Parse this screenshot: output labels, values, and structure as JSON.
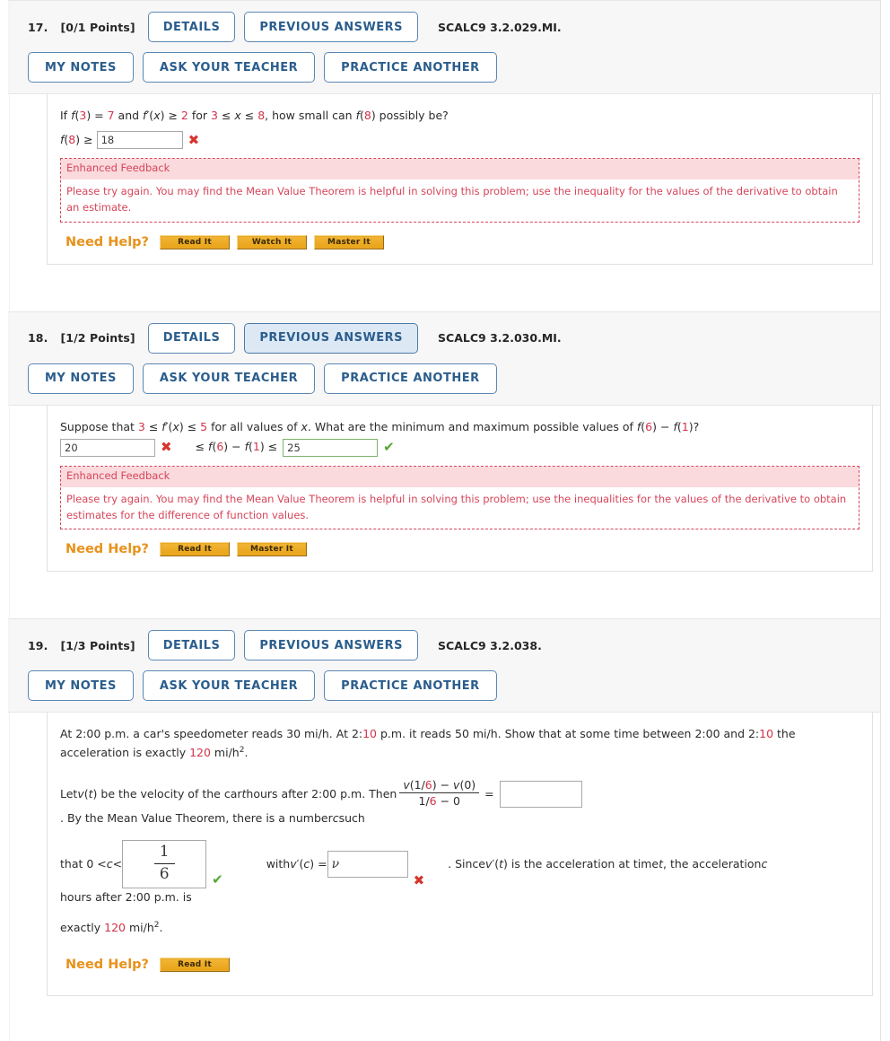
{
  "questions": [
    {
      "number": "17.",
      "points": "[0/1 Points]",
      "code": "SCALC9 3.2.029.MI.",
      "buttons": {
        "details": "DETAILS",
        "previous_answers": "PREVIOUS ANSWERS",
        "my_notes": "MY NOTES",
        "ask_your_teacher": "ASK YOUR TEACHER",
        "practice_another": "PRACTICE ANOTHER"
      },
      "previous_answers_active": false,
      "prompt": {
        "s1": "If ",
        "f1": "f",
        "p1": "(",
        "n3": "3",
        "p2": ") = ",
        "n7": "7",
        "s2": " and ",
        "f2": "f",
        "prime": "′",
        "p3": "(",
        "x1": "x",
        "p4": ") ≥ ",
        "n2": "2",
        "s3": " for ",
        "n3b": "3",
        "le1": " ≤ ",
        "x2": "x",
        "le2": " ≤ ",
        "n8": "8",
        "s4": ", how small can ",
        "f3": "f",
        "p5": "(",
        "n8b": "8",
        "p6": ") possibly be?"
      },
      "answer_line": {
        "f": "f",
        "open": "(",
        "arg": "8",
        "close": ") ≥ ",
        "value": "18",
        "mark": "✖"
      },
      "feedback": {
        "title": "Enhanced Feedback",
        "body": "Please try again. You may find the Mean Value Theorem is helpful in solving this problem; use the inequality for the values of the derivative to obtain an estimate."
      },
      "need_help": {
        "label": "Need Help?",
        "buttons": [
          "Read It",
          "Watch It",
          "Master It"
        ]
      }
    },
    {
      "number": "18.",
      "points": "[1/2 Points]",
      "code": "SCALC9 3.2.030.MI.",
      "buttons": {
        "details": "DETAILS",
        "previous_answers": "PREVIOUS ANSWERS",
        "my_notes": "MY NOTES",
        "ask_your_teacher": "ASK YOUR TEACHER",
        "practice_another": "PRACTICE ANOTHER"
      },
      "previous_answers_active": true,
      "prompt": {
        "s1": "Suppose that ",
        "n3": "3",
        "le1": " ≤ ",
        "f": "f",
        "prime": "′",
        "p1": "(",
        "x": "x",
        "p2": ") ≤ ",
        "n5": "5",
        "s2": " for all values of ",
        "x2": "x",
        "s3": ". What are the minimum and maximum possible values of ",
        "f2": "f",
        "p3": "(",
        "n6": "6",
        "p4": ") − ",
        "f3": "f",
        "p5": "(",
        "n1": "1",
        "p6": ")?"
      },
      "answer_line": {
        "min_value": "20",
        "min_mark": "✖",
        "mid_le1": "≤ ",
        "f1": "f",
        "o1": "(",
        "a1": "6",
        "c1": ") − ",
        "f2": "f",
        "o2": "(",
        "a2": "1",
        "c2": ") ≤",
        "max_value": "25",
        "max_mark": "✔"
      },
      "feedback": {
        "title": "Enhanced Feedback",
        "body": "Please try again. You may find the Mean Value Theorem is helpful in solving this problem; use the inequalities for the values of the derivative to obtain estimates for the difference of function values."
      },
      "need_help": {
        "label": "Need Help?",
        "buttons": [
          "Read It",
          "Master It"
        ]
      }
    },
    {
      "number": "19.",
      "points": "[1/3 Points]",
      "code": "SCALC9 3.2.038.",
      "buttons": {
        "details": "DETAILS",
        "previous_answers": "PREVIOUS ANSWERS",
        "my_notes": "MY NOTES",
        "ask_your_teacher": "ASK YOUR TEACHER",
        "practice_another": "PRACTICE ANOTHER"
      },
      "previous_answers_active": false,
      "prompt": {
        "s1": "At 2:00 p.m. a car's speedometer reads 30 mi/h. At 2:",
        "r1": "10",
        "s2": " p.m. it reads 50 mi/h. Show that at some time between 2:00 and 2:",
        "r2": "10",
        "s3": " the acceleration is exactly ",
        "r3": "120",
        "s4": " mi/h",
        "sup": "2",
        "s5": "."
      },
      "para2": {
        "s1": "Let ",
        "v1": "v",
        "p1": "(",
        "t1": "t",
        "p2": ") be the velocity of the car ",
        "t2": "t",
        "p3": " hours after 2:00 p.m. Then ",
        "frac_num_a": "v",
        "frac_num_b": "(1/",
        "frac_num_red": "6",
        "frac_num_c": ") − ",
        "frac_num_d": "v",
        "frac_num_e": "(0)",
        "frac_den_a": "1/",
        "frac_den_red": "6",
        "frac_den_b": " − 0",
        "eq": "=",
        "box_value": "",
        "s2": ". By the Mean Value Theorem, there is a number ",
        "c1": "c",
        "s3": " such"
      },
      "para3": {
        "s1": "that 0 < ",
        "c1": "c",
        "s2": " < ",
        "frac_num": "1",
        "frac_den": "6",
        "mark1": "✔",
        "s3": "with ",
        "v1": "v",
        "prime": "′",
        "p1": "(",
        "c2": "c",
        "p2": ") = ",
        "box_value": "ν",
        "mark2": "✖",
        "s4": ". Since ",
        "v2": "v",
        "prime2": "′",
        "p3": "(",
        "t1": "t",
        "p4": ") is the acceleration at time ",
        "t2": "t",
        "s5": ", the acceleration ",
        "c3": "c",
        "s6": " hours after 2:00 p.m. is"
      },
      "para4": {
        "s1": "exactly ",
        "r1": "120",
        "s2": " mi/h",
        "sup": "2",
        "s3": "."
      },
      "need_help": {
        "label": "Need Help?",
        "buttons": [
          "Read It"
        ]
      }
    }
  ],
  "colors": {
    "accent_blue": "#2b5d8c",
    "active_blue_bg": "#dce9f5",
    "error_red": "#d6342c",
    "feedback_red": "#d6455a",
    "feedback_bg": "#fadadd",
    "success_green": "#55a630",
    "help_orange": "#e8911a",
    "help_button": "#e8a317",
    "highlight_red": "#d1334a"
  }
}
